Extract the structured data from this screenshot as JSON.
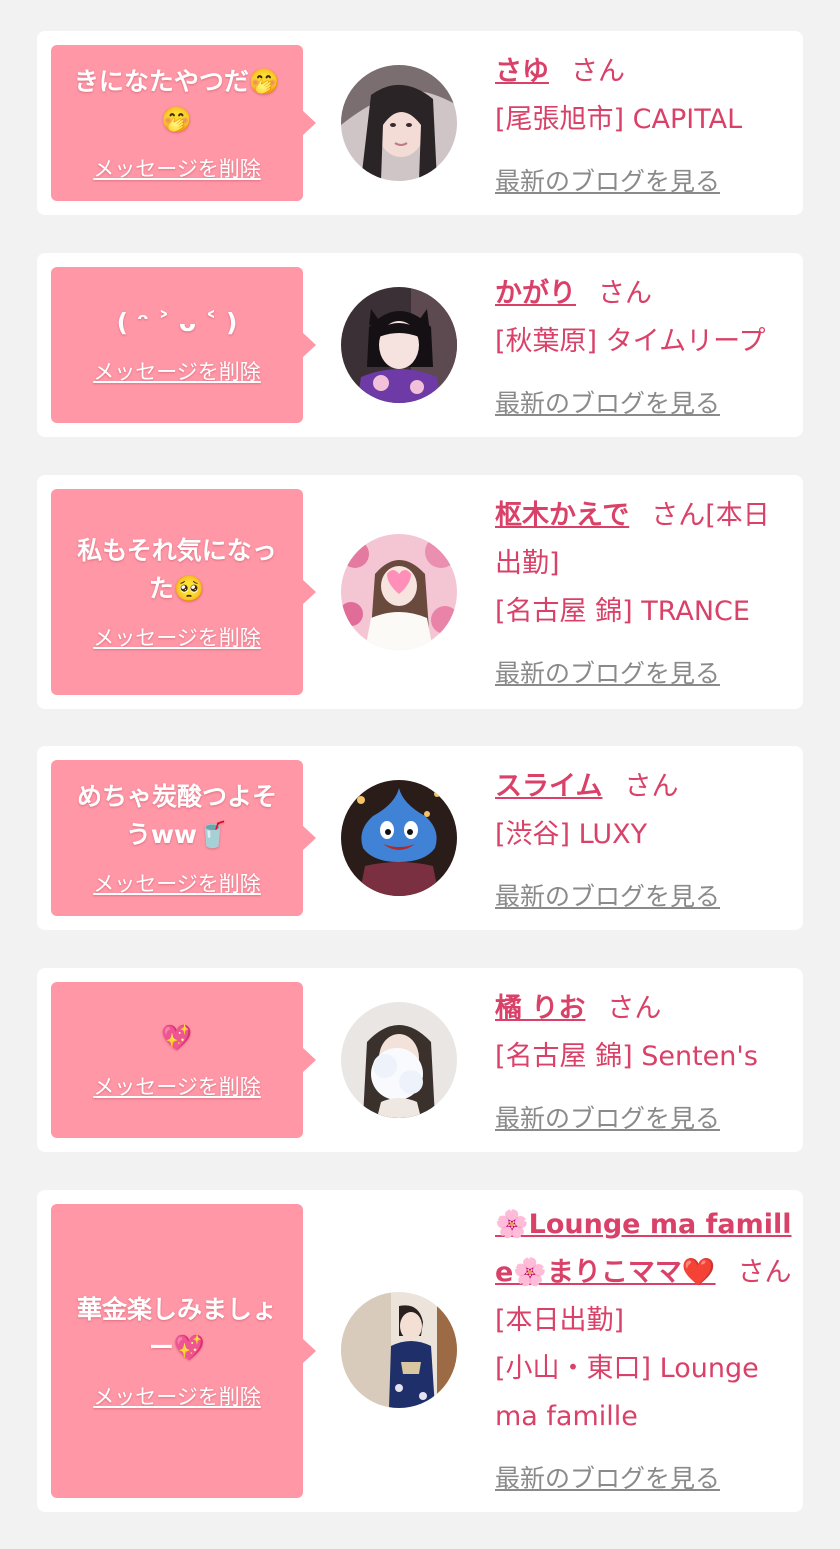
{
  "colors": {
    "page_bg": "#f2f2f2",
    "card_bg": "#ffffff",
    "bubble_bg": "#ff97a6",
    "accent_pink": "#d94168",
    "link_gray": "#8a8a8a"
  },
  "items": [
    {
      "message": "きになたやつだ🤭🤭",
      "delete_label": "メッセージを削除",
      "name": "さゆ",
      "honorific": "さん",
      "shop": "[尾張旭市] CAPITAL",
      "blog_label": "最新のブログを見る",
      "avatar_icon": "avatar-photo-woman-selfie"
    },
    {
      "message": "( ᵔ ˃ ᴗ ˂ )",
      "delete_label": "メッセージを削除",
      "name": "かがり",
      "honorific": "さん",
      "shop": "[秋葉原] タイムリープ",
      "blog_label": "最新のブログを見る",
      "avatar_icon": "avatar-photo-woman-purple-kimono"
    },
    {
      "message": "私もそれ気になった🥺",
      "delete_label": "メッセージを削除",
      "name": "枢木かえで",
      "honorific": "さん[本日出勤]",
      "shop": "[名古屋 錦] TRANCE",
      "blog_label": "最新のブログを見る",
      "avatar_icon": "avatar-photo-woman-cherry-blossoms"
    },
    {
      "message": "めちゃ炭酸つよそうww🥤",
      "delete_label": "メッセージを削除",
      "name": "スライム",
      "honorific": "さん",
      "shop": "[渋谷] LUXY",
      "blog_label": "最新のブログを見る",
      "avatar_icon": "avatar-photo-blue-slime-costume"
    },
    {
      "message": "💖",
      "delete_label": "メッセージを削除",
      "name": "橘 りお",
      "honorific": "さん",
      "shop": "[名古屋 錦] Senten's",
      "blog_label": "最新のブログを見る",
      "avatar_icon": "avatar-photo-woman-blurred-face"
    },
    {
      "message": "華金楽しみましょー💖",
      "delete_label": "メッセージを削除",
      "name": "🌸Lounge ma famille🌸まりこママ❤️",
      "honorific": "さん[本日出勤]",
      "shop": "[小山・東口] Lounge ma famille",
      "blog_label": "最新のブログを見る",
      "avatar_icon": "avatar-photo-woman-navy-kimono"
    }
  ]
}
